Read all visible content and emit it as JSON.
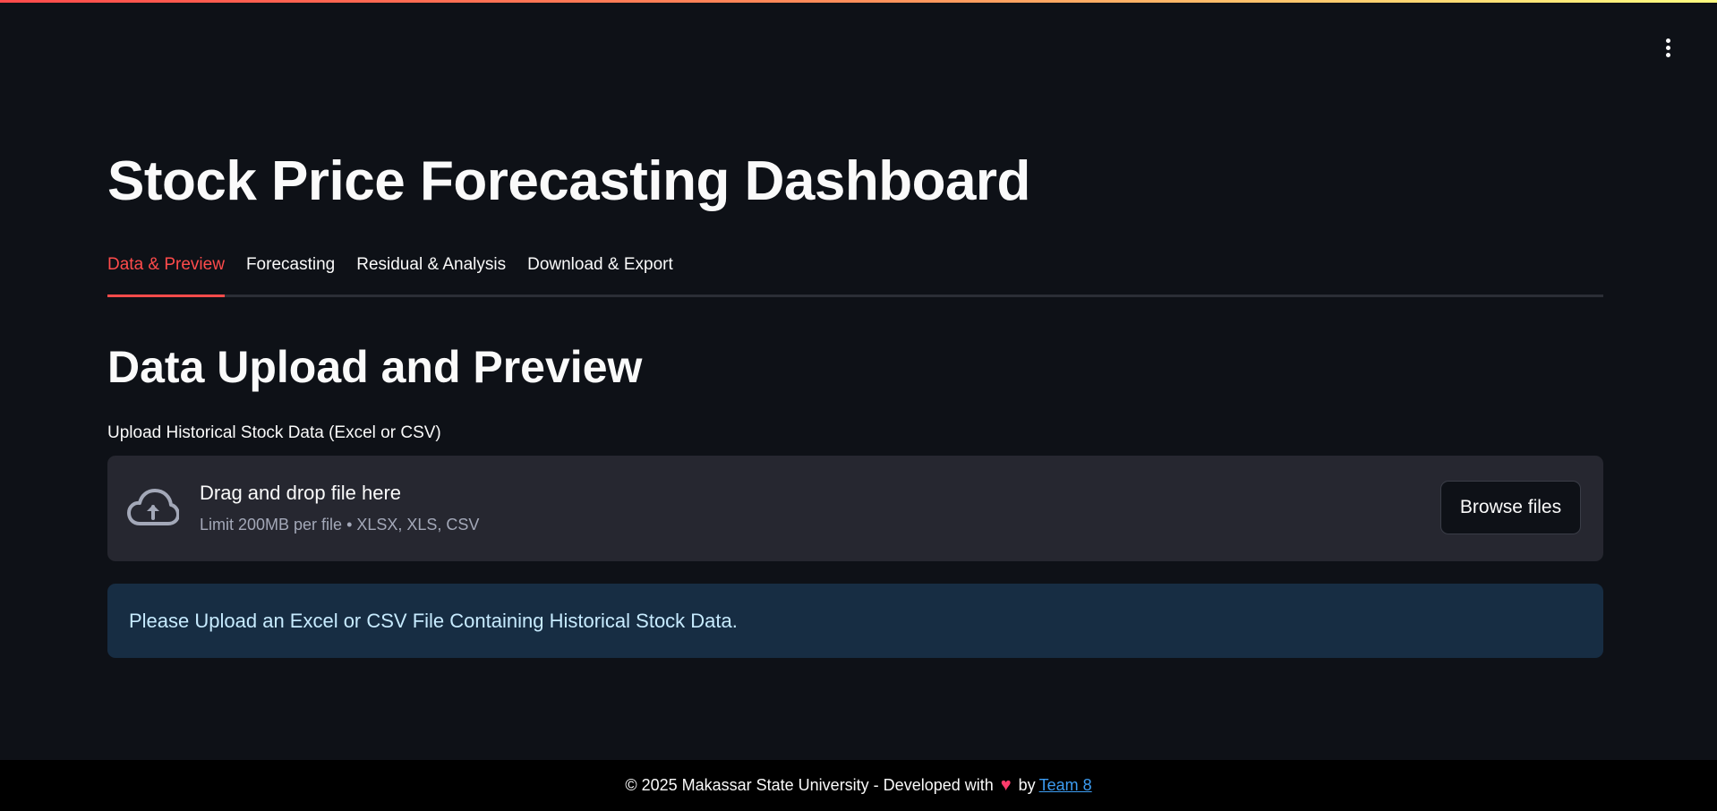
{
  "header": {
    "menu_icon": "kebab-menu-icon"
  },
  "page": {
    "title": "Stock Price Forecasting Dashboard"
  },
  "tabs": [
    {
      "label": "Data & Preview",
      "active": true
    },
    {
      "label": "Forecasting",
      "active": false
    },
    {
      "label": "Residual & Analysis",
      "active": false
    },
    {
      "label": "Download & Export",
      "active": false
    }
  ],
  "section": {
    "title": "Data Upload and Preview"
  },
  "uploader": {
    "label": "Upload Historical Stock Data (Excel or CSV)",
    "icon": "cloud-upload-icon",
    "dropzone_title": "Drag and drop file here",
    "dropzone_subtitle": "Limit 200MB per file • XLSX, XLS, CSV",
    "browse_label": "Browse files"
  },
  "info": {
    "message": "Please Upload an Excel or CSV File Containing Historical Stock Data."
  },
  "footer": {
    "text": "© 2025 Makassar State University - Developed with",
    "heart": "♥",
    "by": "by",
    "link_text": "Team 8"
  },
  "colors": {
    "background": "#0e1117",
    "accent": "#ff4b4b",
    "dropzone_bg": "#262730",
    "info_bg": "#172d43",
    "info_text": "#c7ebff",
    "link": "#3d9df3"
  }
}
